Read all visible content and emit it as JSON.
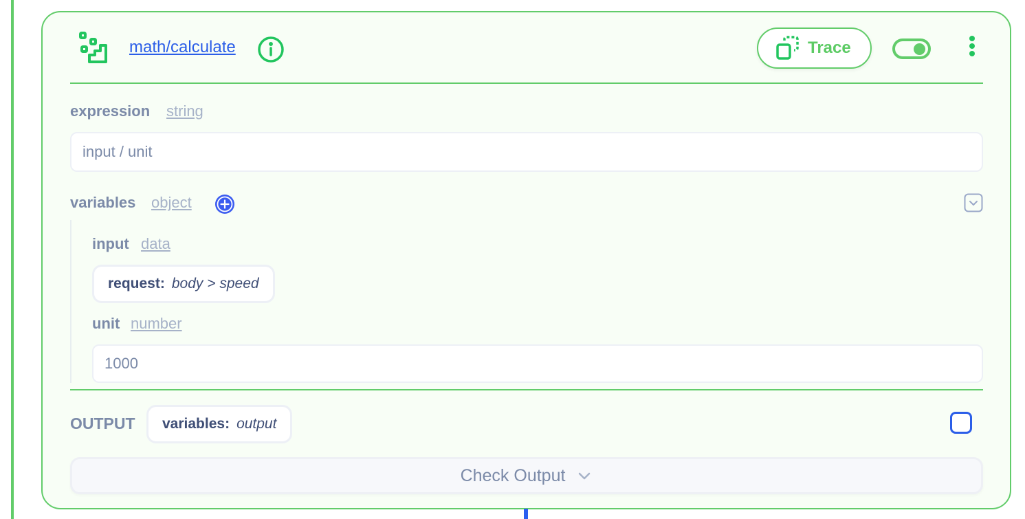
{
  "node": {
    "title": "math/calculate",
    "icon": "step-flow-icon",
    "trace_label": "Trace",
    "toggle_enabled": true,
    "accent_color": "#62cc6a",
    "link_color": "#2b5ee8"
  },
  "fields": {
    "expression": {
      "label": "expression",
      "type": "string",
      "value": "input / unit"
    },
    "variables": {
      "label": "variables",
      "type": "object",
      "children": {
        "input": {
          "label": "input",
          "type": "data",
          "source_key": "request:",
          "source_path": "body > speed"
        },
        "unit": {
          "label": "unit",
          "type": "number",
          "value": "1000"
        }
      }
    }
  },
  "output": {
    "label": "OUTPUT",
    "target_key": "variables:",
    "target_path": "output",
    "checkbox_checked": false
  },
  "check_output": {
    "label": "Check Output"
  }
}
